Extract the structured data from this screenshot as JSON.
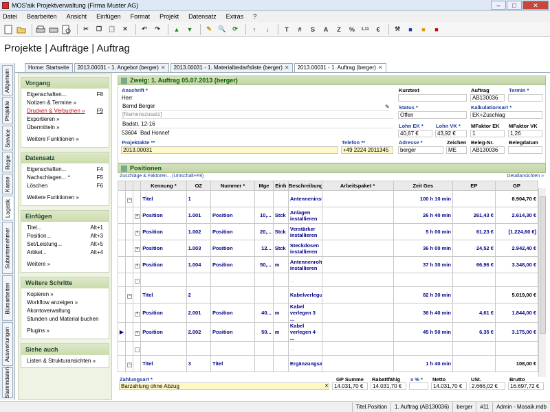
{
  "window": {
    "title": "MOS'aik Projektverwaltung (Firma Muster AG)",
    "min": "–",
    "max": "□",
    "close": "✕"
  },
  "menu": [
    "Datei",
    "Bearbeiten",
    "Ansicht",
    "Einfügen",
    "Format",
    "Projekt",
    "Datensatz",
    "Extras",
    "?"
  ],
  "toolbar_text": [
    "T",
    "#",
    "S",
    "A",
    "Z",
    "%",
    "1,11",
    "€"
  ],
  "page_title": "Projekte | Aufträge | Auftrag",
  "tabs": [
    {
      "label": "Home: Startseite",
      "close": ""
    },
    {
      "label": "2013.00031 - 1. Angebot (berger)",
      "close": "✕"
    },
    {
      "label": "2013.00031 - 1. Materialbedarfsliste (berger)",
      "close": "✕"
    },
    {
      "label": "2013.00031 - 1. Auftrag (berger)",
      "close": "✕"
    }
  ],
  "vtabs": [
    "Allgemein",
    "Projekte",
    "Service",
    "Regie",
    "Kasse",
    "Logistik",
    "Subunternehmer",
    "Büroarbeiten",
    "Auswertungen",
    "Stammdaten"
  ],
  "sidebar": {
    "vorgang": {
      "title": "Vorgang",
      "items": [
        {
          "label": "Eigenschaften...",
          "key": "F8"
        },
        {
          "label": "Notizen & Termine »",
          "key": ""
        },
        {
          "label": "Drucken & Verbuchen »",
          "key": "F9"
        },
        {
          "label": "Exportieren »",
          "key": ""
        },
        {
          "label": "Übermitteln »",
          "key": ""
        }
      ],
      "more": "Weitere Funktionen »"
    },
    "datensatz": {
      "title": "Datensatz",
      "items": [
        {
          "label": "Eigenschaften...",
          "key": "F4"
        },
        {
          "label": "Nachschlagen... *",
          "key": "F5"
        },
        {
          "label": "Löschen",
          "key": "F6"
        }
      ],
      "more": "Weitere Funktionen »"
    },
    "einfuegen": {
      "title": "Einfügen",
      "items": [
        {
          "label": "Titel...",
          "key": "Alt+1"
        },
        {
          "label": "Position...",
          "key": "Alt+3"
        },
        {
          "label": "Set/Leistung...",
          "key": "Alt+5"
        },
        {
          "label": "Artikel...",
          "key": "Alt+4"
        }
      ],
      "more": "Weitere »"
    },
    "schritte": {
      "title": "Weitere Schritte",
      "items": [
        {
          "label": "Kopieren »",
          "key": ""
        },
        {
          "label": "Workflow anzeigen »",
          "key": ""
        },
        {
          "label": "Akontoverwaltung",
          "key": ""
        },
        {
          "label": "Stunden und Material buchen",
          "key": ""
        }
      ],
      "more": "Plugins »"
    },
    "siehe": {
      "title": "Siehe auch",
      "items": [
        {
          "label": "Listen & Strukturansichten »",
          "key": ""
        }
      ]
    }
  },
  "header": {
    "title": "Zweig: 1. Auftrag 05.07.2013 (berger)",
    "anschrift_label": "Anschrift *",
    "anrede": "Herr",
    "name": "Bernd Berger",
    "namenszusatz": "[Namenszusatz]",
    "strasse": "Badstr. 12-16",
    "plz": "53604",
    "ort": "Bad Honnef",
    "projektakte_label": "Projektakte **",
    "projektakte": "2013.00031",
    "telefon_label": "Telefon **",
    "telefon": "+49 2224 2011345",
    "kurztext_label": "Kurztext",
    "kurztext": "",
    "status_label": "Status *",
    "status": "Offen",
    "lohn_ek_label": "Lohn EK *",
    "lohn_ek": "40,67 €",
    "lohn_vk_label": "Lohn VK *",
    "lohn_vk": "43,92 €",
    "adresse_label": "Adresse *",
    "adresse": "berger",
    "zeichen_label": "Zeichen",
    "zeichen": "ME",
    "auftrag_label": "Auftrag",
    "auftrag": "AB130036",
    "termin_label": "Termin *",
    "termin": "",
    "kalk_label": "Kalkulationsart *",
    "kalk": "EK+Zuschlag",
    "mek_label": "MFaktor EK",
    "mek": "1",
    "mvk_label": "MFaktor VK",
    "mvk": "1,26",
    "beleg_label": "Beleg-Nr.",
    "beleg": "AB130036",
    "belegdatum_label": "Belegdatum",
    "belegdatum": ""
  },
  "positions": {
    "title": "Positionen",
    "link_left": "Zuschläge & Faktoren... (Umschalt+F8)",
    "link_right": "Detailansichten »",
    "columns": [
      "Kennung *",
      "OZ",
      "Nummer *",
      "Mge",
      "Einh",
      "Beschreibung",
      "Arbeitspaket *",
      "Zeit Ges",
      "EP",
      "GP"
    ],
    "rows": [
      {
        "kind": "title",
        "kennung": "Titel",
        "oz": "1",
        "nummer": "",
        "mge": "",
        "einh": "",
        "beschr": "Antenneninstallation",
        "ap": "",
        "zeit": "100 h 10 min",
        "ep": "",
        "gp": "8.904,70 €"
      },
      {
        "kind": "pos",
        "kennung": "Position",
        "oz": "1.001",
        "nummer": "Position",
        "mge": "10,...",
        "einh": "Stck",
        "beschr": "Anlagen installieren",
        "ap": "",
        "zeit": "26 h 40 min",
        "ep": "261,43 €",
        "gp": "2.614,30 €"
      },
      {
        "kind": "pos",
        "kennung": "Position",
        "oz": "1.002",
        "nummer": "Position",
        "mge": "20,...",
        "einh": "Stck",
        "beschr": "Verstärker installieren",
        "ap": "",
        "zeit": "5 h 00 min",
        "ep": "61,23 €",
        "gp": "[1.224,60 €]"
      },
      {
        "kind": "pos",
        "kennung": "Position",
        "oz": "1.003",
        "nummer": "Position",
        "mge": "12...",
        "einh": "Stck",
        "beschr": "Steckdosen installieren",
        "ap": "",
        "zeit": "36 h 00 min",
        "ep": "24,52 €",
        "gp": "2.942,40 €"
      },
      {
        "kind": "pos",
        "kennung": "Position",
        "oz": "1.004",
        "nummer": "Position",
        "mge": "50,...",
        "einh": "m",
        "beschr": "Antennenrohr installieren",
        "ap": "",
        "zeit": "37 h 30 min",
        "ep": "66,96 €",
        "gp": "3.348,00 €"
      },
      {
        "kind": "empty",
        "kennung": "",
        "oz": "",
        "nummer": "",
        "mge": "",
        "einh": "",
        "beschr": "...",
        "ap": "",
        "zeit": "",
        "ep": "",
        "gp": ""
      },
      {
        "kind": "title",
        "kennung": "Titel",
        "oz": "2",
        "nummer": "",
        "mge": "",
        "einh": "",
        "beschr": "Kabelverlegung",
        "ap": "",
        "zeit": "82 h 30 min",
        "ep": "",
        "gp": "5.019,00 €"
      },
      {
        "kind": "pos",
        "kennung": "Position",
        "oz": "2.001",
        "nummer": "Position",
        "mge": "40...",
        "einh": "m",
        "beschr": "Kabel verlegen 3 ...",
        "ap": "",
        "zeit": "36 h 40 min",
        "ep": "4,61 €",
        "gp": "1.844,00 €"
      },
      {
        "kind": "pos",
        "kennung": "Position",
        "oz": "2.002",
        "nummer": "Position",
        "mge": "50...",
        "einh": "m",
        "beschr": "Kabel verlegen 4 ...",
        "ap": "",
        "zeit": "45 h 50 min",
        "ep": "6,35 €",
        "gp": "3.175,00 €"
      },
      {
        "kind": "empty",
        "kennung": "",
        "oz": "",
        "nummer": "",
        "mge": "",
        "einh": "",
        "beschr": "...",
        "ap": "",
        "zeit": "",
        "ep": "",
        "gp": ""
      },
      {
        "kind": "title",
        "kennung": "Titel",
        "oz": "3",
        "nummer": "Titel",
        "mge": "",
        "einh": "",
        "beschr": "Ergänzungsarbeiten",
        "ap": "",
        "zeit": "1 h 40 min",
        "ep": "",
        "gp": "108,00 €"
      }
    ]
  },
  "footer": {
    "zahlungsart_label": "Zahlungsart *",
    "zahlungsart": "Barzahlung ohne Abzug",
    "gpsumme_label": "GP Summe",
    "gpsumme": "14.031,70 €",
    "rabatt_label": "Rabattfähig",
    "rabatt": "14.031,70 €",
    "pct_label": "± % *",
    "pct": "",
    "netto_label": "Netto",
    "netto": "14.031,70 €",
    "ust_label": "USt.",
    "ust": "2.666,02 €",
    "brutto_label": "Brutto",
    "brutto": "16.697,72 €"
  },
  "status": [
    "Titel.Position",
    "1. Auftrag (AB130036)",
    "berger",
    "#11",
    "Admin - Mosaik.mdb"
  ]
}
